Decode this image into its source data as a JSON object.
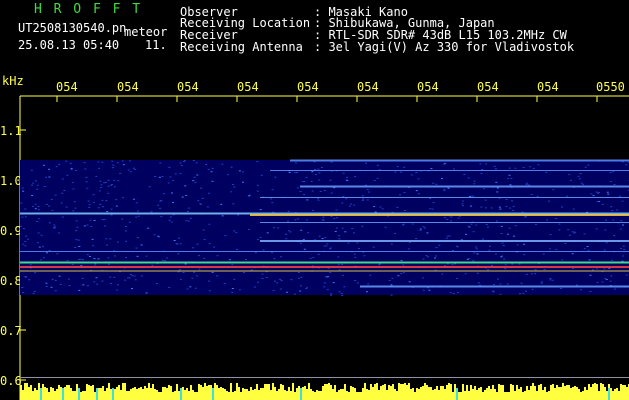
{
  "header": {
    "brand": "H R O F F T",
    "filename": "UT2508130540.pn",
    "subtitle": "meteor",
    "date_time": "25.08.13 05:40",
    "counter": "11.",
    "info": [
      {
        "label": "Observer",
        "value": ": Masaki Kano"
      },
      {
        "label": "Receiving Location",
        "value": ": Shibukawa, Gunma, Japan"
      },
      {
        "label": "Receiver",
        "value": ": RTL-SDR SDR# 43dB L15 103.2MHz CW"
      },
      {
        "label": "Receiving Antenna",
        "value": ": 3el Yagi(V) Az 330 for Vladivostok"
      }
    ]
  },
  "axis": {
    "unit": "kHz",
    "freq_ticks": [
      "1.1",
      "1.0",
      "0.9",
      "0.8",
      "0.7",
      "0.6"
    ],
    "time_ticks": [
      "054",
      "054",
      "054",
      "054",
      "054",
      "054",
      "054",
      "054",
      "054",
      "0550"
    ]
  },
  "colors": {
    "text_white": "#ffffff",
    "brand_green": "#3fdc3f",
    "axis_yellow": "#ffff4a",
    "spectrogram_bg": "#000040",
    "trace_blue": "#6aa0ff"
  }
}
